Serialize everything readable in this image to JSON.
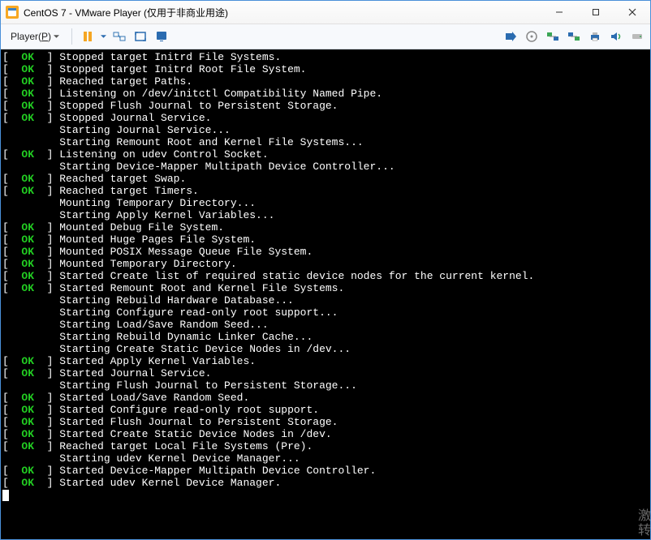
{
  "window": {
    "title": "CentOS 7 - VMware Player (仅用于非商业用途)"
  },
  "toolbar": {
    "player_label": "Player(P)",
    "icons": {
      "pause": "pause-icon",
      "fit": "fit-guest-icon",
      "fullscreen": "fullscreen-icon",
      "unity": "unity-icon",
      "sendkey": "send-key-icon",
      "cd": "cd-icon",
      "net1": "network-icon",
      "net2": "network2-icon",
      "printer": "printer-icon",
      "sound": "sound-icon",
      "drive": "drive-icon"
    }
  },
  "watermark": {
    "line1": "激",
    "line2": "转"
  },
  "terminal": {
    "lines": [
      {
        "s": "OK",
        "t": "Stopped target Initrd File Systems."
      },
      {
        "s": "OK",
        "t": "Stopped target Initrd Root File System."
      },
      {
        "s": "OK",
        "t": "Reached target Paths."
      },
      {
        "s": "OK",
        "t": "Listening on /dev/initctl Compatibility Named Pipe."
      },
      {
        "s": "OK",
        "t": "Stopped Flush Journal to Persistent Storage."
      },
      {
        "s": "OK",
        "t": "Stopped Journal Service."
      },
      {
        "s": "",
        "t": "Starting Journal Service..."
      },
      {
        "s": "",
        "t": "Starting Remount Root and Kernel File Systems..."
      },
      {
        "s": "OK",
        "t": "Listening on udev Control Socket."
      },
      {
        "s": "",
        "t": "Starting Device-Mapper Multipath Device Controller..."
      },
      {
        "s": "OK",
        "t": "Reached target Swap."
      },
      {
        "s": "OK",
        "t": "Reached target Timers."
      },
      {
        "s": "",
        "t": "Mounting Temporary Directory..."
      },
      {
        "s": "",
        "t": "Starting Apply Kernel Variables..."
      },
      {
        "s": "OK",
        "t": "Mounted Debug File System."
      },
      {
        "s": "OK",
        "t": "Mounted Huge Pages File System."
      },
      {
        "s": "OK",
        "t": "Mounted POSIX Message Queue File System."
      },
      {
        "s": "OK",
        "t": "Mounted Temporary Directory."
      },
      {
        "s": "OK",
        "t": "Started Create list of required static device nodes for the current kernel."
      },
      {
        "s": "OK",
        "t": "Started Remount Root and Kernel File Systems."
      },
      {
        "s": "",
        "t": "Starting Rebuild Hardware Database..."
      },
      {
        "s": "",
        "t": "Starting Configure read-only root support..."
      },
      {
        "s": "",
        "t": "Starting Load/Save Random Seed..."
      },
      {
        "s": "",
        "t": "Starting Rebuild Dynamic Linker Cache..."
      },
      {
        "s": "",
        "t": "Starting Create Static Device Nodes in /dev..."
      },
      {
        "s": "OK",
        "t": "Started Apply Kernel Variables."
      },
      {
        "s": "OK",
        "t": "Started Journal Service."
      },
      {
        "s": "",
        "t": "Starting Flush Journal to Persistent Storage..."
      },
      {
        "s": "OK",
        "t": "Started Load/Save Random Seed."
      },
      {
        "s": "OK",
        "t": "Started Configure read-only root support."
      },
      {
        "s": "OK",
        "t": "Started Flush Journal to Persistent Storage."
      },
      {
        "s": "OK",
        "t": "Started Create Static Device Nodes in /dev."
      },
      {
        "s": "OK",
        "t": "Reached target Local File Systems (Pre)."
      },
      {
        "s": "",
        "t": "Starting udev Kernel Device Manager..."
      },
      {
        "s": "OK",
        "t": "Started Device-Mapper Multipath Device Controller."
      },
      {
        "s": "OK",
        "t": "Started udev Kernel Device Manager."
      }
    ]
  }
}
